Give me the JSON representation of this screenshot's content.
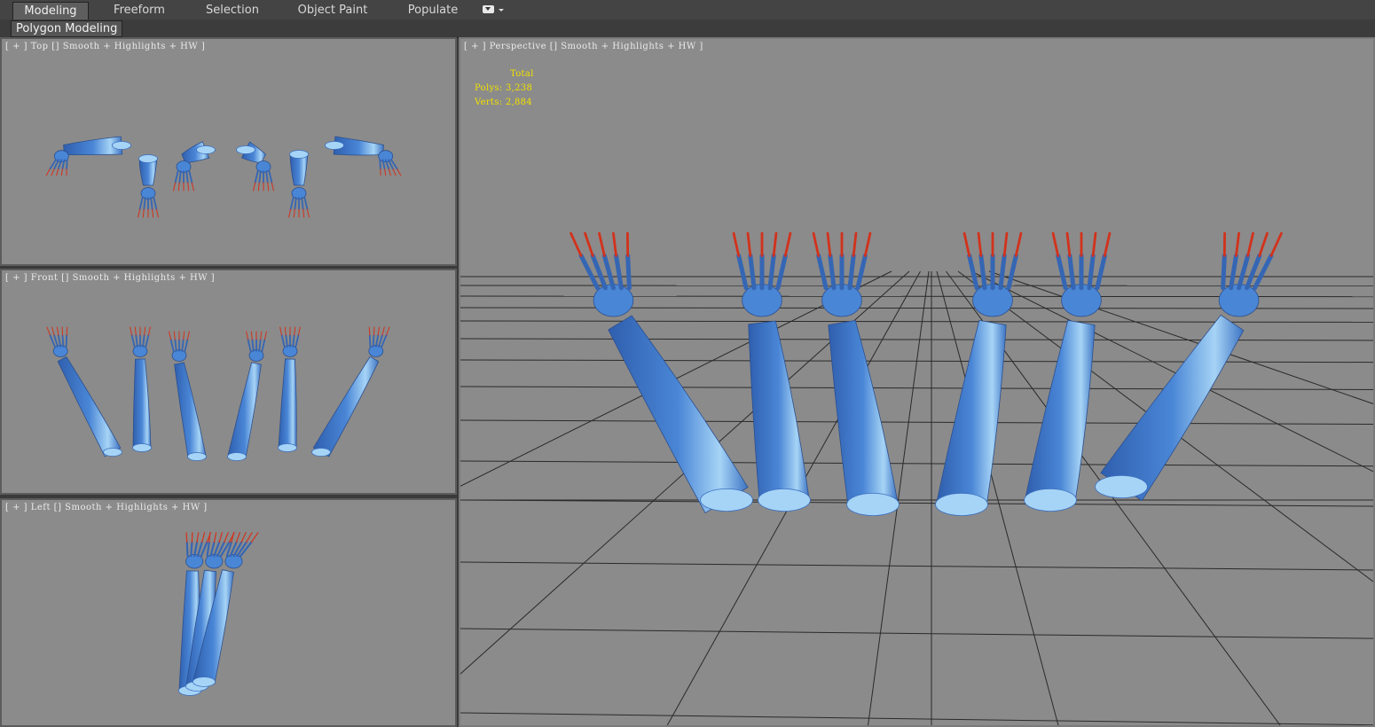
{
  "ribbon": {
    "tabs": [
      {
        "label": "Modeling",
        "active": true
      },
      {
        "label": "Freeform",
        "active": false
      },
      {
        "label": "Selection",
        "active": false
      },
      {
        "label": "Object Paint",
        "active": false
      },
      {
        "label": "Populate",
        "active": false
      }
    ],
    "options_icon": "dropdown-options-icon"
  },
  "panel": {
    "label": "Polygon Modeling"
  },
  "viewports": {
    "top": {
      "label": "[ + ] Top [] Smooth + Highlights + HW ]"
    },
    "front": {
      "label": "[ + ] Front [] Smooth + Highlights + HW ]"
    },
    "left": {
      "label": "[ + ] Left [] Smooth + Highlights + HW ]"
    },
    "perspective": {
      "label": "[ + ] Perspective [] Smooth + Highlights + HW ]"
    }
  },
  "stats": {
    "header": "Total",
    "polys_label": "Polys:",
    "polys_value": "3,238",
    "verts_label": "Verts:",
    "verts_value": "2,884"
  },
  "colors": {
    "viewport_bg": "#8b8b8b",
    "mesh_blue": "#4a86d6",
    "mesh_light": "#a6d4f6",
    "claw_red": "#d2321c",
    "stats_yellow": "#f0e000",
    "grid_line": "#2a2a2a"
  }
}
